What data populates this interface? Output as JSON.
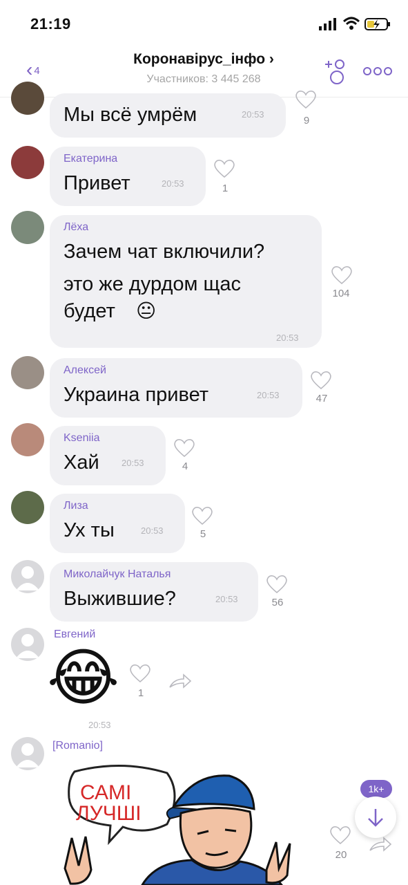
{
  "status_bar": {
    "time": "21:19"
  },
  "header": {
    "back_count": "4",
    "title": "Коронавірус_інфо ›",
    "subtitle": "Участников: 3 445 268"
  },
  "messages": [
    {
      "sender": "",
      "text": "Мы всё умрём",
      "time": "20:53",
      "likes": "9"
    },
    {
      "sender": "Екатерина",
      "text": "Привет",
      "time": "20:53",
      "likes": "1"
    },
    {
      "sender": "Лёха",
      "lines": [
        "Зачем чат включили?",
        "это же дурдом щас",
        "будет"
      ],
      "emoji": "😐",
      "time": "20:53",
      "likes": "104"
    },
    {
      "sender": "Алексей",
      "text": "Украина привет",
      "time": "20:53",
      "likes": "47"
    },
    {
      "sender": "Kseniia",
      "text": "Хай",
      "time": "20:53",
      "likes": "4"
    },
    {
      "sender": "Лиза",
      "text": "Ух ты",
      "time": "20:53",
      "likes": "5"
    },
    {
      "sender": "Миколайчук Наталья",
      "text": "Выжившие?",
      "time": "20:53",
      "likes": "56"
    },
    {
      "sender": "Евгений",
      "emoji": "😂",
      "time": "20:53",
      "likes": "1"
    },
    {
      "sender": "[Romanio]",
      "sticker_text": [
        "САМІ",
        "ЛУЧШІ"
      ],
      "likes": "20"
    }
  ],
  "scroll_badge": "1k+",
  "colors": {
    "accent": "#7e64c8",
    "bubble": "#f0f0f3",
    "time": "#b4b4b8"
  }
}
